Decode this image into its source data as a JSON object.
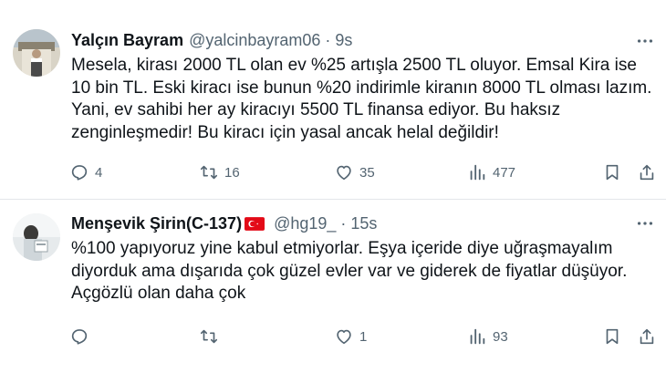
{
  "tweets": [
    {
      "name": "Yalçın Bayram",
      "handle": "@yalcinbayram06",
      "separator": "·",
      "time": "9s",
      "lines": [
        "Mesela, kirası 2000 TL olan ev %25 artışla 2500 TL oluyor. Emsal Kira ise",
        "10 bin TL. Eski kiracı ise bunun %20 indirimle kiranın 8000 TL olması lazım.",
        "Yani, ev sahibi her ay kiracıyı 5500 TL finansa ediyor. Bu haksız",
        "zenginleşmedir! Bu kiracı için yasal ancak helal değildir!"
      ],
      "replies": "4",
      "retweets": "16",
      "likes": "35",
      "views": "477",
      "icons": [
        "reply-icon",
        "retweet-icon",
        "like-icon",
        "views-icon",
        "bookmark-icon",
        "share-icon",
        "more-icon"
      ]
    },
    {
      "name": "Menşevik Şirin(C-137)",
      "flag": "turkey-flag",
      "handle": "@hg19_",
      "separator": "·",
      "time": "15s",
      "lines": [
        "%100 yapıyoruz yine kabul etmiyorlar. Eşya içeride diye uğraşmayalım",
        "diyorduk ama dışarıda çok güzel evler var ve giderek de fiyatlar düşüyor.",
        "Açgözlü olan daha çok"
      ],
      "replies": "",
      "retweets": "",
      "likes": "1",
      "views": "93",
      "icons": [
        "reply-icon",
        "retweet-icon",
        "like-icon",
        "views-icon",
        "bookmark-icon",
        "share-icon",
        "more-icon"
      ]
    }
  ],
  "colors": {
    "text": "#0f1419",
    "secondary": "#536471",
    "divider": "#e3e6ea",
    "flag_red": "#e30a17"
  }
}
